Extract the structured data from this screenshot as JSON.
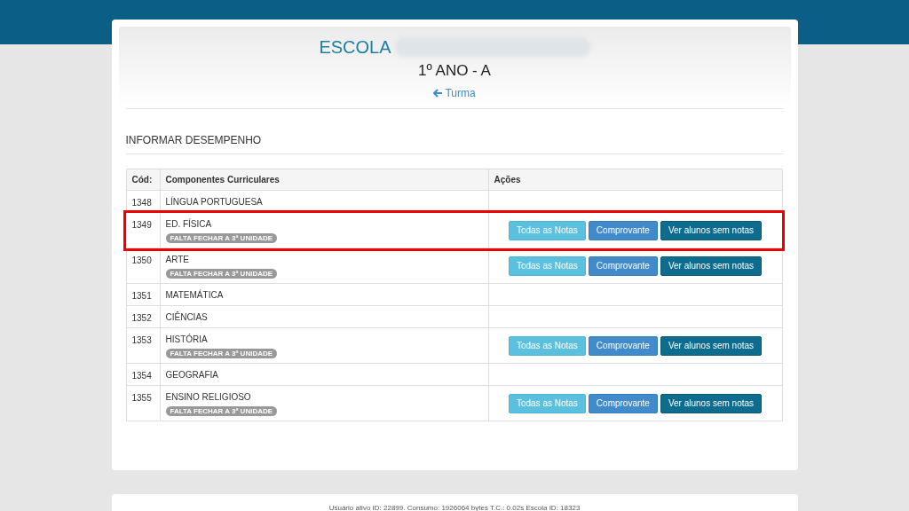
{
  "header": {
    "school_label": "ESCOLA",
    "class_title": "1º ANO - A",
    "back_link": "Turma"
  },
  "section_title": "INFORMAR DESEMPENHO",
  "table": {
    "columns": [
      "Cód:",
      "Componentes Curriculares",
      "Ações"
    ],
    "rows": [
      {
        "code": "1348",
        "name": "LÍNGUA PORTUGUESA",
        "highlighted": false
      },
      {
        "code": "1349",
        "name": "ED. FÍSICA",
        "badge": "FALTA FECHAR A 3ª UNIDADE",
        "actions": [
          "Todas as Notas",
          "Comprovante",
          "Ver alunos sem notas"
        ],
        "highlighted": true
      },
      {
        "code": "1350",
        "name": "ARTE",
        "badge": "FALTA FECHAR A 3ª UNIDADE",
        "actions": [
          "Todas as Notas",
          "Comprovante",
          "Ver alunos sem notas"
        ],
        "highlighted": false
      },
      {
        "code": "1351",
        "name": "MATEMÁTICA",
        "highlighted": false
      },
      {
        "code": "1352",
        "name": "CIÊNCIAS",
        "highlighted": false
      },
      {
        "code": "1353",
        "name": "HISTÓRIA",
        "badge": "FALTA FECHAR A 3ª UNIDADE",
        "actions": [
          "Todas as Notas",
          "Comprovante",
          "Ver alunos sem notas"
        ],
        "highlighted": false
      },
      {
        "code": "1354",
        "name": "GEOGRAFIA",
        "highlighted": false
      },
      {
        "code": "1355",
        "name": "ENSINO RELIGIOSO",
        "badge": "FALTA FECHAR A 3ª UNIDADE",
        "actions": [
          "Todas as Notas",
          "Comprovante",
          "Ver alunos sem notas"
        ],
        "highlighted": false
      }
    ]
  },
  "footer": "Usuário ativo ID: 22899. Consumo: 1926064 bytes T.C.: 0.02s Escola ID: 18323"
}
